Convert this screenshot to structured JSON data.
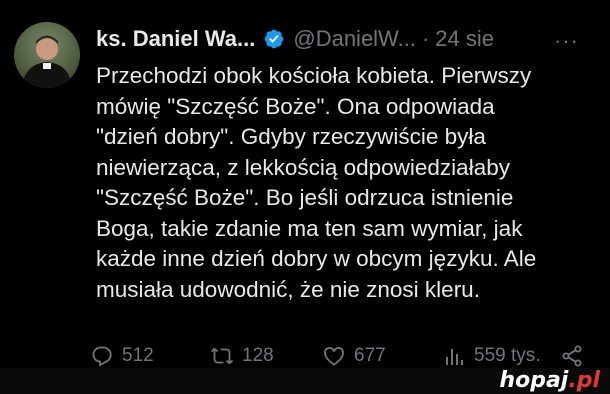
{
  "author": {
    "name": "ks. Daniel Wa...",
    "handle": "@DanielW...",
    "separator": "·",
    "date": "24 sie",
    "verified": true
  },
  "more_label": "···",
  "tweet_lines": [
    "Przechodzi obok kościoła kobieta. Pierwszy",
    "mówię \"Szczęść Boże\". Ona odpowiada",
    "\"dzień dobry\". Gdyby rzeczywiście była",
    "niewierząca, z lekkością odpowiedziałaby",
    "\"Szczęść Boże\". Bo jeśli odrzuca istnienie",
    "Boga, takie zdanie ma ten sam wymiar, jak",
    "każde inne dzień dobry w obcym języku. Ale",
    "musiała udowodnić, że nie znosi kleru."
  ],
  "actions": {
    "replies": "512",
    "retweets": "128",
    "likes": "677",
    "views": "559 tys."
  },
  "icons": {
    "verified": "verified-badge-icon",
    "reply": "reply-icon",
    "retweet": "retweet-icon",
    "like": "heart-icon",
    "views": "views-icon",
    "share": "share-icon",
    "more": "more-icon"
  },
  "watermark": {
    "main": "hopaj",
    "suffix": ".pl"
  },
  "colors": {
    "background": "#000000",
    "text": "#e7e9ea",
    "muted": "#71767b",
    "verified": "#1d9bf0",
    "watermark_accent": "#e23b2f"
  }
}
